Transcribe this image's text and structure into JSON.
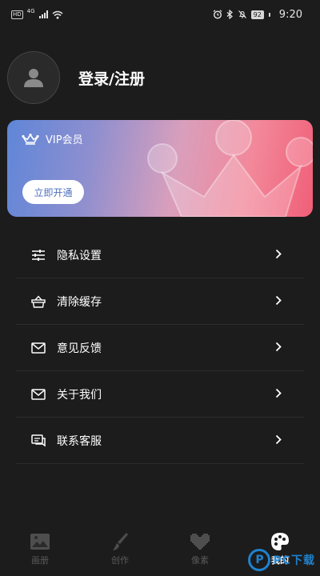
{
  "status_bar": {
    "hd_label": "HD",
    "network_label": "4G",
    "battery_level": "92",
    "time": "9:20"
  },
  "profile": {
    "login_label": "登录/注册"
  },
  "vip_card": {
    "title": "VIP会员",
    "button_label": "立即开通"
  },
  "menu": {
    "items": [
      {
        "label": "隐私设置",
        "icon": "sliders-icon"
      },
      {
        "label": "清除缓存",
        "icon": "basket-icon"
      },
      {
        "label": "意见反馈",
        "icon": "mail-icon"
      },
      {
        "label": "关于我们",
        "icon": "mail-icon"
      },
      {
        "label": "联系客服",
        "icon": "chat-icon"
      }
    ]
  },
  "bottom_nav": {
    "items": [
      {
        "label": "画册",
        "icon": "image-icon",
        "active": false
      },
      {
        "label": "创作",
        "icon": "brush-icon",
        "active": false
      },
      {
        "label": "像素",
        "icon": "pixel-heart-icon",
        "active": false
      },
      {
        "label": "我的",
        "icon": "palette-icon",
        "active": true
      }
    ]
  },
  "watermark": {
    "logo_letter": "P",
    "text": "PC下载"
  },
  "colors": {
    "background": "#1c1c1c",
    "text_primary": "#ffffff",
    "nav_inactive": "#5a5a5a",
    "vip_gradient_start": "#5f86d8",
    "vip_gradient_end": "#f05f78",
    "watermark_blue": "#1f88d8"
  }
}
